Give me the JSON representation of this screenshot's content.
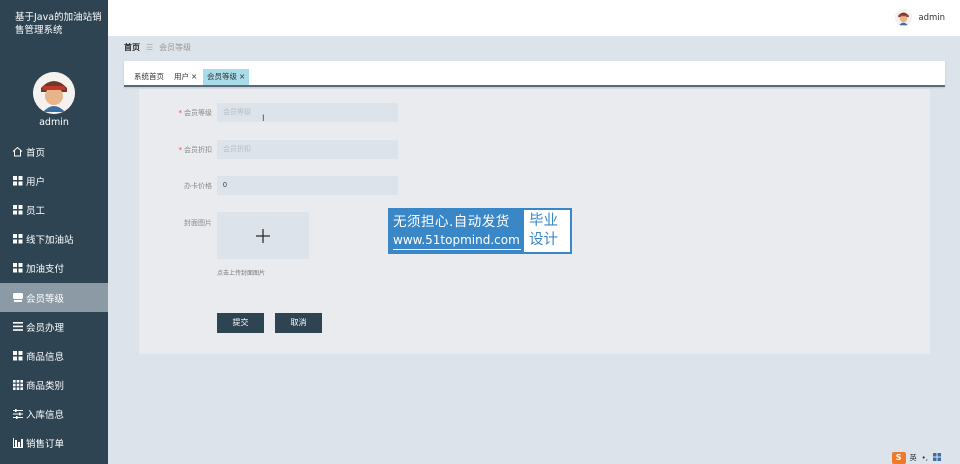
{
  "app": {
    "title": "基于Java的加油站销售管理系统"
  },
  "sidebar": {
    "username": "admin",
    "items": [
      {
        "label": "首页",
        "icon": "home-icon",
        "active": false
      },
      {
        "label": "用户",
        "icon": "grid-icon",
        "active": false
      },
      {
        "label": "员工",
        "icon": "grid-icon",
        "active": false
      },
      {
        "label": "线下加油站",
        "icon": "grid-icon",
        "active": false
      },
      {
        "label": "加油支付",
        "icon": "grid-icon",
        "active": false
      },
      {
        "label": "会员等级",
        "icon": "card-icon",
        "active": true
      },
      {
        "label": "会员办理",
        "icon": "list-icon",
        "active": false
      },
      {
        "label": "商品信息",
        "icon": "grid-icon",
        "active": false
      },
      {
        "label": "商品类别",
        "icon": "apps-icon",
        "active": false
      },
      {
        "label": "入库信息",
        "icon": "sliders-icon",
        "active": false
      },
      {
        "label": "销售订单",
        "icon": "chart-icon",
        "active": false
      }
    ]
  },
  "topbar": {
    "username": "admin"
  },
  "breadcrumb": {
    "home": "首页",
    "separator": "☰",
    "current": "会员等级"
  },
  "tabs": [
    {
      "label": "系统首页",
      "closable": false,
      "active": false
    },
    {
      "label": "用户",
      "closable": true,
      "active": false
    },
    {
      "label": "会员等级",
      "closable": true,
      "active": true
    }
  ],
  "form": {
    "level": {
      "label": "会员等级",
      "placeholder": "会员等级",
      "value": "",
      "required": true
    },
    "discount": {
      "label": "会员折扣",
      "placeholder": "会员折扣",
      "value": "",
      "required": true
    },
    "price": {
      "label": "办卡价格",
      "value": "0",
      "required": false
    },
    "cover": {
      "label": "封面图片",
      "hint": "点击上传封面图片"
    },
    "submit_label": "提交",
    "cancel_label": "取消"
  },
  "watermark": {
    "line1": "无须担心.自动发货",
    "line2": "www.51topmind.com",
    "right1": "毕业",
    "right2": "设计"
  },
  "tray": {
    "ime": "英",
    "logo": "S"
  },
  "colors": {
    "sidebar": "#2e4453",
    "active_tab": "#a9dcea",
    "accent": "#3a87c8",
    "required": "#e74c3c"
  }
}
